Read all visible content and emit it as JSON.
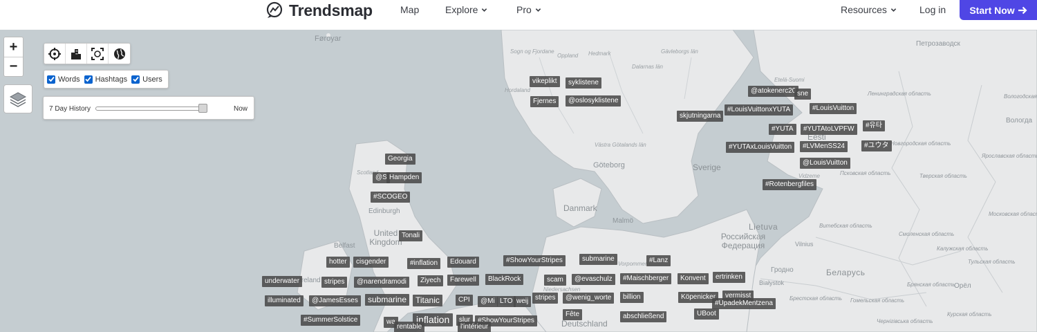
{
  "header": {
    "brand": "Trendsmap",
    "nav": [
      {
        "label": "Map",
        "dropdown": false
      },
      {
        "label": "Explore",
        "dropdown": true
      },
      {
        "label": "Pro",
        "dropdown": true
      }
    ],
    "resources": "Resources",
    "login": "Log in",
    "cta": "Start Now",
    "accent": "#4f46e5"
  },
  "controls": {
    "zoom_in": "+",
    "zoom_out": "−",
    "toolbar_icons": [
      "crosshair-icon",
      "city-icon",
      "expand-frame-icon",
      "globe-icon"
    ],
    "filters": [
      {
        "label": "Words",
        "checked": true
      },
      {
        "label": "Hashtags",
        "checked": true
      },
      {
        "label": "Users",
        "checked": true
      }
    ],
    "history_label": "7 Day History",
    "history_end": "Now",
    "history_position": 1.0
  },
  "places": [
    {
      "text": "Føroyar",
      "cls": ""
    },
    {
      "text": "Sogn og Fjordane",
      "cls": "tiny"
    },
    {
      "text": "Oppland",
      "cls": "tiny"
    },
    {
      "text": "Hedmark",
      "cls": "tiny"
    },
    {
      "text": "Dalarnas län",
      "cls": "tiny"
    },
    {
      "text": "Gävleborgs län",
      "cls": "tiny"
    },
    {
      "text": "Hordaland",
      "cls": "tiny"
    },
    {
      "text": "Västra Götalands län",
      "cls": "tiny"
    },
    {
      "text": "Göteborg",
      "cls": ""
    },
    {
      "text": "Sverige",
      "cls": "big"
    },
    {
      "text": "Etelä-Suomi",
      "cls": "tiny"
    },
    {
      "text": "Eesti",
      "cls": "big"
    },
    {
      "text": "Vidzeme",
      "cls": "tiny"
    },
    {
      "text": "Петрозаводск",
      "cls": ""
    },
    {
      "text": "Ленинградская область",
      "cls": "right"
    },
    {
      "text": "Вологодская область",
      "cls": "right"
    },
    {
      "text": "Вологда",
      "cls": ""
    },
    {
      "text": "Новгородская область",
      "cls": "right"
    },
    {
      "text": "Ярославская область",
      "cls": "right"
    },
    {
      "text": "Псковская область",
      "cls": "right"
    },
    {
      "text": "Тверская область",
      "cls": "right"
    },
    {
      "text": "Scotland",
      "cls": "tiny"
    },
    {
      "text": "Edinburgh",
      "cls": ""
    },
    {
      "text": "United Kingdom",
      "cls": "big"
    },
    {
      "text": "Belfast",
      "cls": ""
    },
    {
      "text": "Danmark",
      "cls": "big"
    },
    {
      "text": "Malmö",
      "cls": ""
    },
    {
      "text": "Lietuva",
      "cls": "big caps"
    },
    {
      "text": "Российская Федерация",
      "cls": "big"
    },
    {
      "text": "Vilnius",
      "cls": ""
    },
    {
      "text": "Витебская область",
      "cls": "right"
    },
    {
      "text": "Смоленская область",
      "cls": "right"
    },
    {
      "text": "Московская область",
      "cls": "right"
    },
    {
      "text": "Калужская область",
      "cls": "right"
    },
    {
      "text": "Тульская область",
      "cls": "right"
    },
    {
      "text": "Гродно",
      "cls": ""
    },
    {
      "text": "Беларусь",
      "cls": "big caps"
    },
    {
      "text": "Białystok",
      "cls": ""
    },
    {
      "text": "Брестская область",
      "cls": "right"
    },
    {
      "text": "Гомельская область",
      "cls": "right"
    },
    {
      "text": "Брянская область",
      "cls": "right"
    },
    {
      "text": "Орёл",
      "cls": ""
    },
    {
      "text": "Курская область",
      "cls": "right"
    },
    {
      "text": "Чернігівська область",
      "cls": "right"
    },
    {
      "text": "Deutschland",
      "cls": "big"
    },
    {
      "text": "Niedersachsen",
      "cls": "tiny"
    },
    {
      "text": "Vorpommern",
      "cls": "tiny"
    },
    {
      "text": "Ireland",
      "cls": ""
    }
  ],
  "trends": [
    {
      "text": "vikeplikt"
    },
    {
      "text": "syklistene"
    },
    {
      "text": "Fjernes"
    },
    {
      "text": "@oslosyklistene"
    },
    {
      "text": "@atokenerc20"
    },
    {
      "text": "sne"
    },
    {
      "text": "#LouisVuittonxYUTA"
    },
    {
      "text": "#LouisVuitton"
    },
    {
      "text": "skjutningarna"
    },
    {
      "text": "#YUTA"
    },
    {
      "text": "#YUTAtoLVPFW"
    },
    {
      "text": "#유타"
    },
    {
      "text": "#YUTAxLouisVuitton"
    },
    {
      "text": "#LVMenSS24"
    },
    {
      "text": "#ユウタ"
    },
    {
      "text": "@LouisVuitton"
    },
    {
      "text": "#Rotenbergfiles"
    },
    {
      "text": "Georgia"
    },
    {
      "text": "@S"
    },
    {
      "text": "Hampden"
    },
    {
      "text": "#SCOGEO"
    },
    {
      "text": "Tonali"
    },
    {
      "text": "hotter"
    },
    {
      "text": "cisgender"
    },
    {
      "text": "#inflation"
    },
    {
      "text": "Edouard"
    },
    {
      "text": "#ShowYourStripes"
    },
    {
      "text": "submarine"
    },
    {
      "text": "#Lanz"
    },
    {
      "text": "underwater"
    },
    {
      "text": "stripes"
    },
    {
      "text": "@narendramodi"
    },
    {
      "text": "Ziyech"
    },
    {
      "text": "Farewell"
    },
    {
      "text": "BlackRock"
    },
    {
      "text": "scam"
    },
    {
      "text": "@evaschulz"
    },
    {
      "text": "#Maischberger"
    },
    {
      "text": "Konvent"
    },
    {
      "text": "ertrinken"
    },
    {
      "text": "illuminated"
    },
    {
      "text": "@JamesEsses"
    },
    {
      "text": "submarine"
    },
    {
      "text": "Titanic"
    },
    {
      "text": "CPI"
    },
    {
      "text": "@Mi"
    },
    {
      "text": "LTO"
    },
    {
      "text": "weij"
    },
    {
      "text": "stripes"
    },
    {
      "text": "@wenig_worte"
    },
    {
      "text": "billion"
    },
    {
      "text": "Köpenicker"
    },
    {
      "text": "vermisst"
    },
    {
      "text": "#UpadekMentzena"
    },
    {
      "text": "#SummerSolstice"
    },
    {
      "text": "wa"
    },
    {
      "text": "inflation"
    },
    {
      "text": "slur"
    },
    {
      "text": "#ShowYourStripes"
    },
    {
      "text": "Fête"
    },
    {
      "text": "abschließend"
    },
    {
      "text": "UBoot"
    },
    {
      "text": "rentable"
    },
    {
      "text": "l'intérieur"
    }
  ]
}
